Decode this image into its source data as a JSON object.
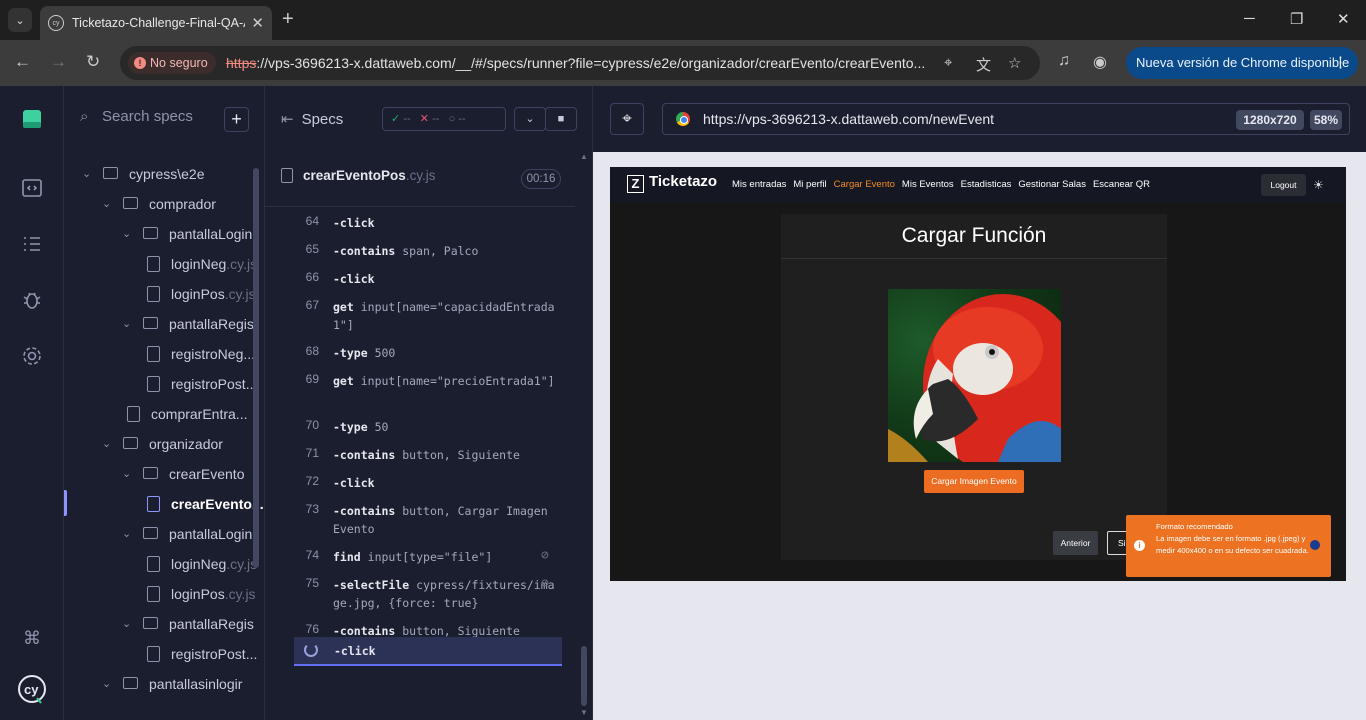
{
  "browser": {
    "tab_title": "Ticketazo-Challenge-Final-QA-A",
    "security_label": "No seguro",
    "url_scheme": "https",
    "url_rest": "://vps-3696213-x.dattaweb.com/__/#/specs/runner?file=cypress/e2e/organizador/crearEvento/crearEvento...",
    "update_label": "Nueva versión de Chrome disponible"
  },
  "specs": {
    "search_placeholder": "Search specs",
    "tree": [
      {
        "label": "cypress\\e2e",
        "ext": "",
        "kind": "folder",
        "depth": 0
      },
      {
        "label": "comprador",
        "ext": "",
        "kind": "folder",
        "depth": 1
      },
      {
        "label": "pantallaLogin",
        "ext": "",
        "kind": "folder",
        "depth": 2
      },
      {
        "label": "loginNeg",
        "ext": ".cy.js",
        "kind": "file",
        "depth": 3
      },
      {
        "label": "loginPos",
        "ext": ".cy.js",
        "kind": "file",
        "depth": 3
      },
      {
        "label": "pantallaRegis",
        "ext": "",
        "kind": "folder",
        "depth": 2
      },
      {
        "label": "registroNeg...",
        "ext": "",
        "kind": "file",
        "depth": 3
      },
      {
        "label": "registroPost...",
        "ext": "",
        "kind": "file",
        "depth": 3
      },
      {
        "label": "comprarEntra...",
        "ext": "",
        "kind": "file",
        "depth": 2
      },
      {
        "label": "organizador",
        "ext": "",
        "kind": "folder",
        "depth": 1
      },
      {
        "label": "crearEvento",
        "ext": "",
        "kind": "folder",
        "depth": 2
      },
      {
        "label": "crearEvento...",
        "ext": "",
        "kind": "file",
        "depth": 3,
        "active": true
      },
      {
        "label": "pantallaLogin",
        "ext": "",
        "kind": "folder",
        "depth": 2
      },
      {
        "label": "loginNeg",
        "ext": ".cy.js",
        "kind": "file",
        "depth": 3
      },
      {
        "label": "loginPos",
        "ext": ".cy.js",
        "kind": "file",
        "depth": 3
      },
      {
        "label": "pantallaRegis",
        "ext": "",
        "kind": "folder",
        "depth": 2
      },
      {
        "label": "registroPost...",
        "ext": "",
        "kind": "file",
        "depth": 3
      },
      {
        "label": "pantallasinlogir",
        "ext": "",
        "kind": "folder",
        "depth": 1
      }
    ]
  },
  "reporter": {
    "header": "Specs",
    "passed": "--",
    "failed": "--",
    "pending": "--",
    "spec_name": "crearEventoPos",
    "spec_ext": ".cy.js",
    "duration": "00:16",
    "commands": [
      {
        "n": "64",
        "name": "-click",
        "msg": ""
      },
      {
        "n": "65",
        "name": "-contains",
        "msg": "span, Palco"
      },
      {
        "n": "66",
        "name": "-click",
        "msg": ""
      },
      {
        "n": "67",
        "name": "get",
        "msg": "input[name=\"capacidadEntrada1\"]"
      },
      {
        "n": "68",
        "name": "-type",
        "msg": "500"
      },
      {
        "n": "69",
        "name": "get",
        "msg": "input[name=\"precioEntrada1\"]"
      },
      {
        "n": "70",
        "name": "-type",
        "msg": "50"
      },
      {
        "n": "71",
        "name": "-contains",
        "msg": "button, Siguiente"
      },
      {
        "n": "72",
        "name": "-click",
        "msg": ""
      },
      {
        "n": "73",
        "name": "-contains",
        "msg": "button, Cargar Imagen Evento"
      },
      {
        "n": "74",
        "name": "find",
        "msg": "input[type=\"file\"]",
        "hidden": true
      },
      {
        "n": "75",
        "name": "-selectFile",
        "msg": "cypress/fixtures/image.jpg, {force: true}",
        "hidden": true
      },
      {
        "n": "76",
        "name": "-contains",
        "msg": "button, Siguiente"
      }
    ],
    "running_command": "-click"
  },
  "aut": {
    "url": "https://vps-3696213-x.dattaweb.com/newEvent",
    "viewport": "1280x720",
    "zoom": "58%"
  },
  "app": {
    "brand": "Ticketazo",
    "nav": [
      "Mis entradas",
      "Mi perfil",
      "Cargar Evento",
      "Mis Eventos",
      "Estadisticas",
      "Gestionar Salas",
      "Escanear QR"
    ],
    "logout": "Logout",
    "title": "Cargar Función",
    "upload_button": "Cargar Imagen Evento",
    "prev_button": "Anterior",
    "next_button": "Si",
    "toast_title": "Formato recomendado",
    "toast_text": "La imagen debe ser en formato .jpg (.jpeg) y medir 400x400 o en su defecto ser cuadrada."
  },
  "colors": {
    "accent": "#ec6d22",
    "cypress_bg": "#1b1e2e",
    "active": "#8e93ff"
  }
}
